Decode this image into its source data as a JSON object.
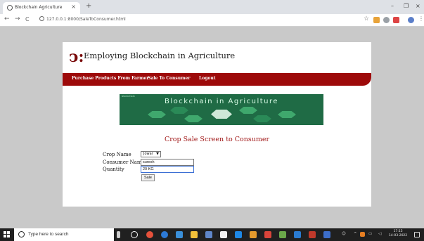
{
  "browser": {
    "tab_title": "Blockchain Agriculture",
    "tab_close": "×",
    "new_tab": "+",
    "url": "127.0.0.1:8000/SaleToConsumer.html",
    "back": "←",
    "forward": "→",
    "reload": "C",
    "star": "☆",
    "minimize": "–",
    "restore": "❐",
    "close": "×"
  },
  "site": {
    "logo": "ↄ:",
    "title": "Employing Blockchain in Agriculture",
    "menu": [
      "Purchase Products From Farmer",
      "Sale To Consumer",
      "Logout"
    ],
    "banner_text": "Blockchain in Agriculture",
    "banner_tag": "blockchain"
  },
  "form": {
    "heading": "Crop Sale Screen to Consumer",
    "crop_label": "Crop Name",
    "crop_value": "Jowar",
    "consumer_label": "Consumer Name",
    "consumer_value": "suresh",
    "quantity_label": "Quantity",
    "quantity_value": "20 KG",
    "submit_label": "Sale"
  },
  "taskbar": {
    "search_placeholder": "Type here to search",
    "time": "17:15",
    "date": "14-03-2022"
  },
  "colors": {
    "menubar": "#9d0a0a",
    "heading": "#a11818",
    "banner": "#1f6b45",
    "page_bg": "#c9c9c9"
  }
}
